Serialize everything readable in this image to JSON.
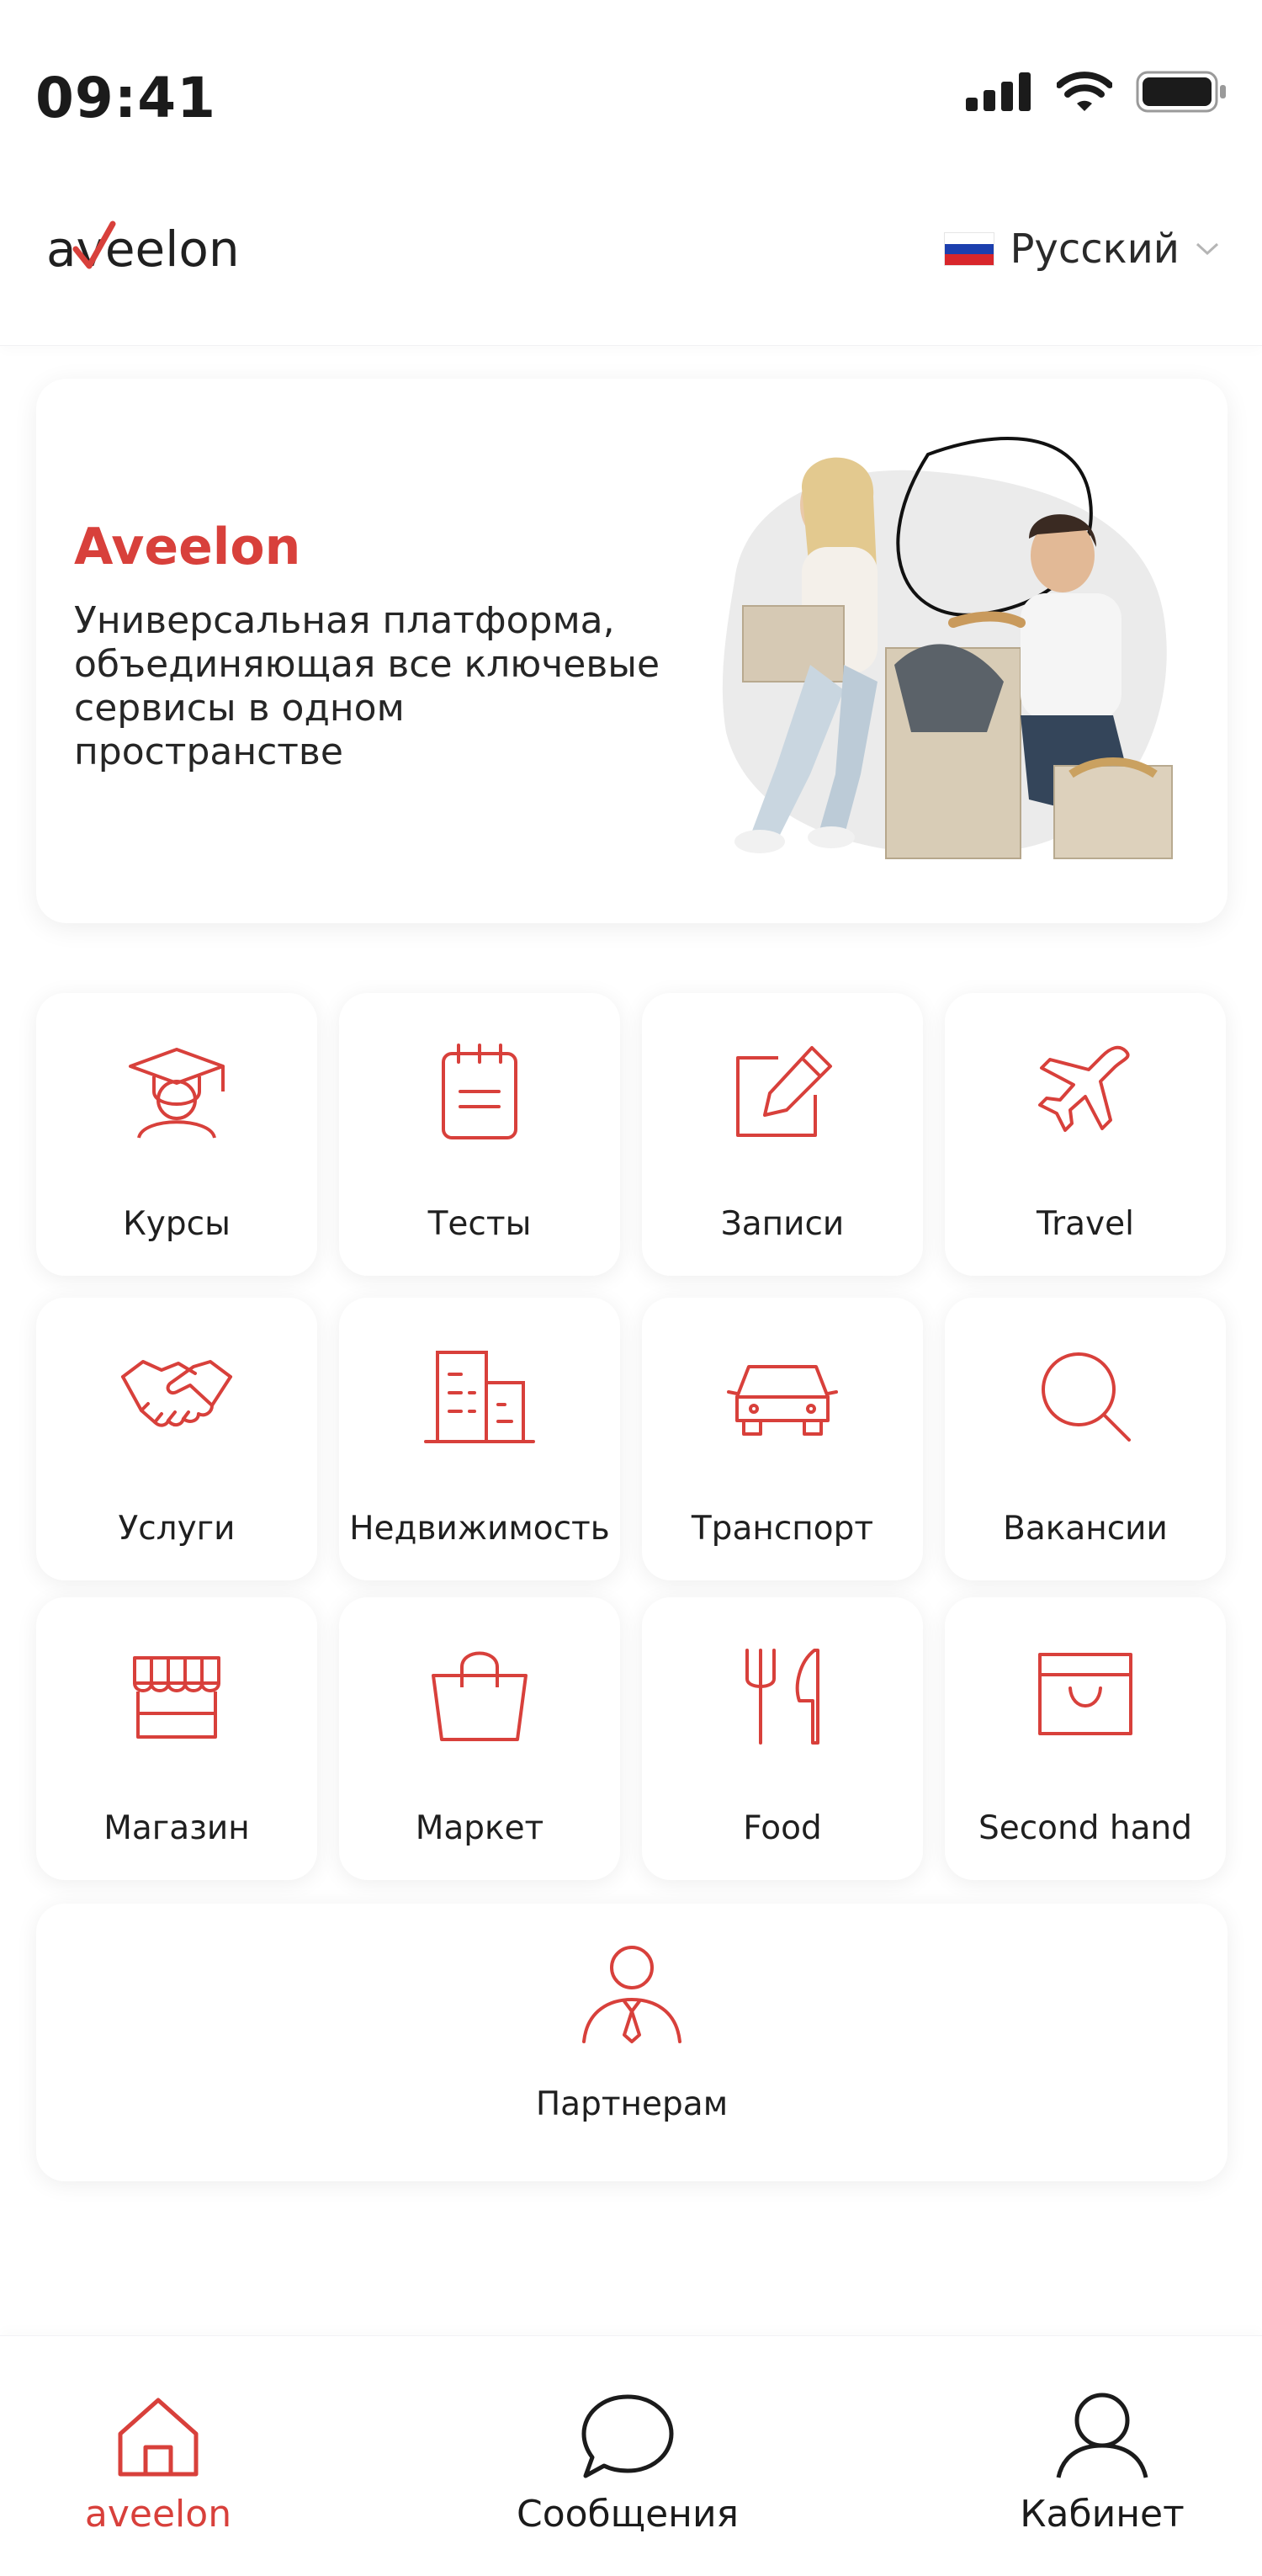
{
  "status_bar": {
    "time": "09:41"
  },
  "header": {
    "logo": "aveelon",
    "language": "Русский"
  },
  "hero": {
    "title": "Aveelon",
    "text": "Универсальная платформа, объединяющая все ключевые сервисы в одном пространстве"
  },
  "services": [
    {
      "label": "Курсы",
      "icon": "graduation-cap-icon"
    },
    {
      "label": "Тесты",
      "icon": "notepad-icon"
    },
    {
      "label": "Записи",
      "icon": "edit-icon"
    },
    {
      "label": "Travel",
      "icon": "airplane-icon"
    },
    {
      "label": "Услуги",
      "icon": "handshake-icon"
    },
    {
      "label": "Недвижимость",
      "icon": "buildings-icon"
    },
    {
      "label": "Транспорт",
      "icon": "car-icon"
    },
    {
      "label": "Вакансии",
      "icon": "search-icon"
    },
    {
      "label": "Магазин",
      "icon": "store-icon"
    },
    {
      "label": "Маркет",
      "icon": "shopping-bag-icon"
    },
    {
      "label": "Food",
      "icon": "fork-knife-icon"
    },
    {
      "label": "Second hand",
      "icon": "box-icon"
    }
  ],
  "partners": {
    "label": "Партнерам",
    "icon": "partner-person-icon"
  },
  "tabbar": [
    {
      "label": "aveelon",
      "icon": "home-icon",
      "active": true
    },
    {
      "label": "Сообщения",
      "icon": "chat-bubble-icon",
      "active": false
    },
    {
      "label": "Кабинет",
      "icon": "user-icon",
      "active": false
    }
  ],
  "colors": {
    "accent": "#d8403b",
    "text": "#1f1f1f",
    "background": "#ffffff"
  }
}
